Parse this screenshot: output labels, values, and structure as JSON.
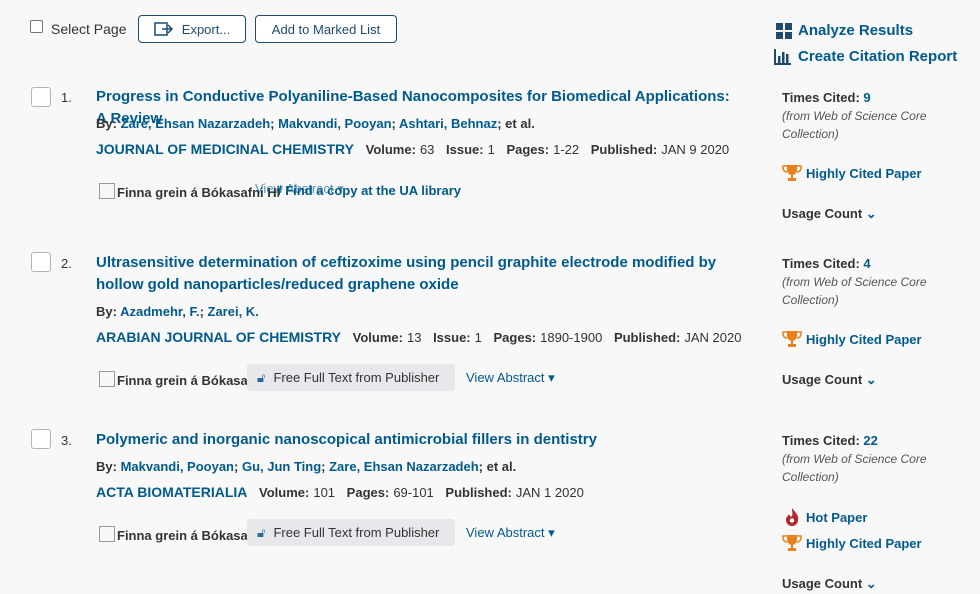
{
  "toolbar": {
    "select_page": "Select Page",
    "export": "Export...",
    "add_marked": "Add to Marked List"
  },
  "right_links": {
    "analyze": "Analyze Results",
    "citation_report": "Create Citation Report"
  },
  "records": [
    {
      "num": "1.",
      "title": "Progress in Conductive Polyaniline-Based Nanocomposites for Biomedical Applications: A Review",
      "by": "By:",
      "authors": [
        "Zare, Ehsan Nazarzadeh",
        "Makvandi, Pooyan",
        "Ashtari, Behnaz"
      ],
      "et_al": "; et al.",
      "journal": "JOURNAL OF MEDICINAL CHEMISTRY",
      "volume_label": "Volume:",
      "volume": "63",
      "issue_label": "Issue:",
      "issue": "1",
      "pages_label": "Pages:",
      "pages": "1-22",
      "published_label": "Published:",
      "published": "JAN 9 2020",
      "image_alt": "Finna grein á Bókasafni HÍ",
      "view_abstract": "View Abstract",
      "find_copy": "/ Find a copy at the UA library",
      "times_cited_label": "Times Cited:",
      "times_cited": "9",
      "cited_note": "(from Web of Science Core Collection)",
      "highly_cited": "Highly Cited Paper",
      "usage": "Usage Count"
    },
    {
      "num": "2.",
      "title": "Ultrasensitive determination of ceftizoxime using pencil graphite electrode modified by hollow gold nanoparticles/reduced graphene oxide",
      "by": "By:",
      "authors": [
        "Azadmehr, F.",
        "Zarei, K."
      ],
      "journal": "ARABIAN JOURNAL OF CHEMISTRY",
      "volume_label": "Volume:",
      "volume": "13",
      "issue_label": "Issue:",
      "issue": "1",
      "pages_label": "Pages:",
      "pages": "1890-1900",
      "published_label": "Published:",
      "published": "JAN 2020",
      "image_alt": "Finna grein á Bókasafni",
      "free_full_text": "Free Full Text from Publisher",
      "view_abstract": "View Abstract",
      "times_cited_label": "Times Cited:",
      "times_cited": "4",
      "cited_note": "(from Web of Science Core Collection)",
      "highly_cited": "Highly Cited Paper",
      "usage": "Usage Count"
    },
    {
      "num": "3.",
      "title": "Polymeric and inorganic nanoscopical antimicrobial fillers in dentistry",
      "by": "By:",
      "authors": [
        "Makvandi, Pooyan",
        "Gu, Jun Ting",
        "Zare, Ehsan Nazarzadeh"
      ],
      "et_al": "; et al.",
      "journal": "ACTA BIOMATERIALIA",
      "volume_label": "Volume:",
      "volume": "101",
      "pages_label": "Pages:",
      "pages": "69-101",
      "published_label": "Published:",
      "published": "JAN 1 2020",
      "image_alt": "Finna grein á Bókasafni",
      "free_full_text": "Free Full Text from Publisher",
      "view_abstract": "View Abstract",
      "times_cited_label": "Times Cited:",
      "times_cited": "22",
      "cited_note": "(from Web of Science Core Collection)",
      "hot_paper": "Hot Paper",
      "highly_cited": "Highly Cited Paper",
      "usage": "Usage Count"
    }
  ],
  "colors": {
    "link": "#005a8c",
    "trophy": "#e8801c",
    "hot": "#b3262b"
  }
}
